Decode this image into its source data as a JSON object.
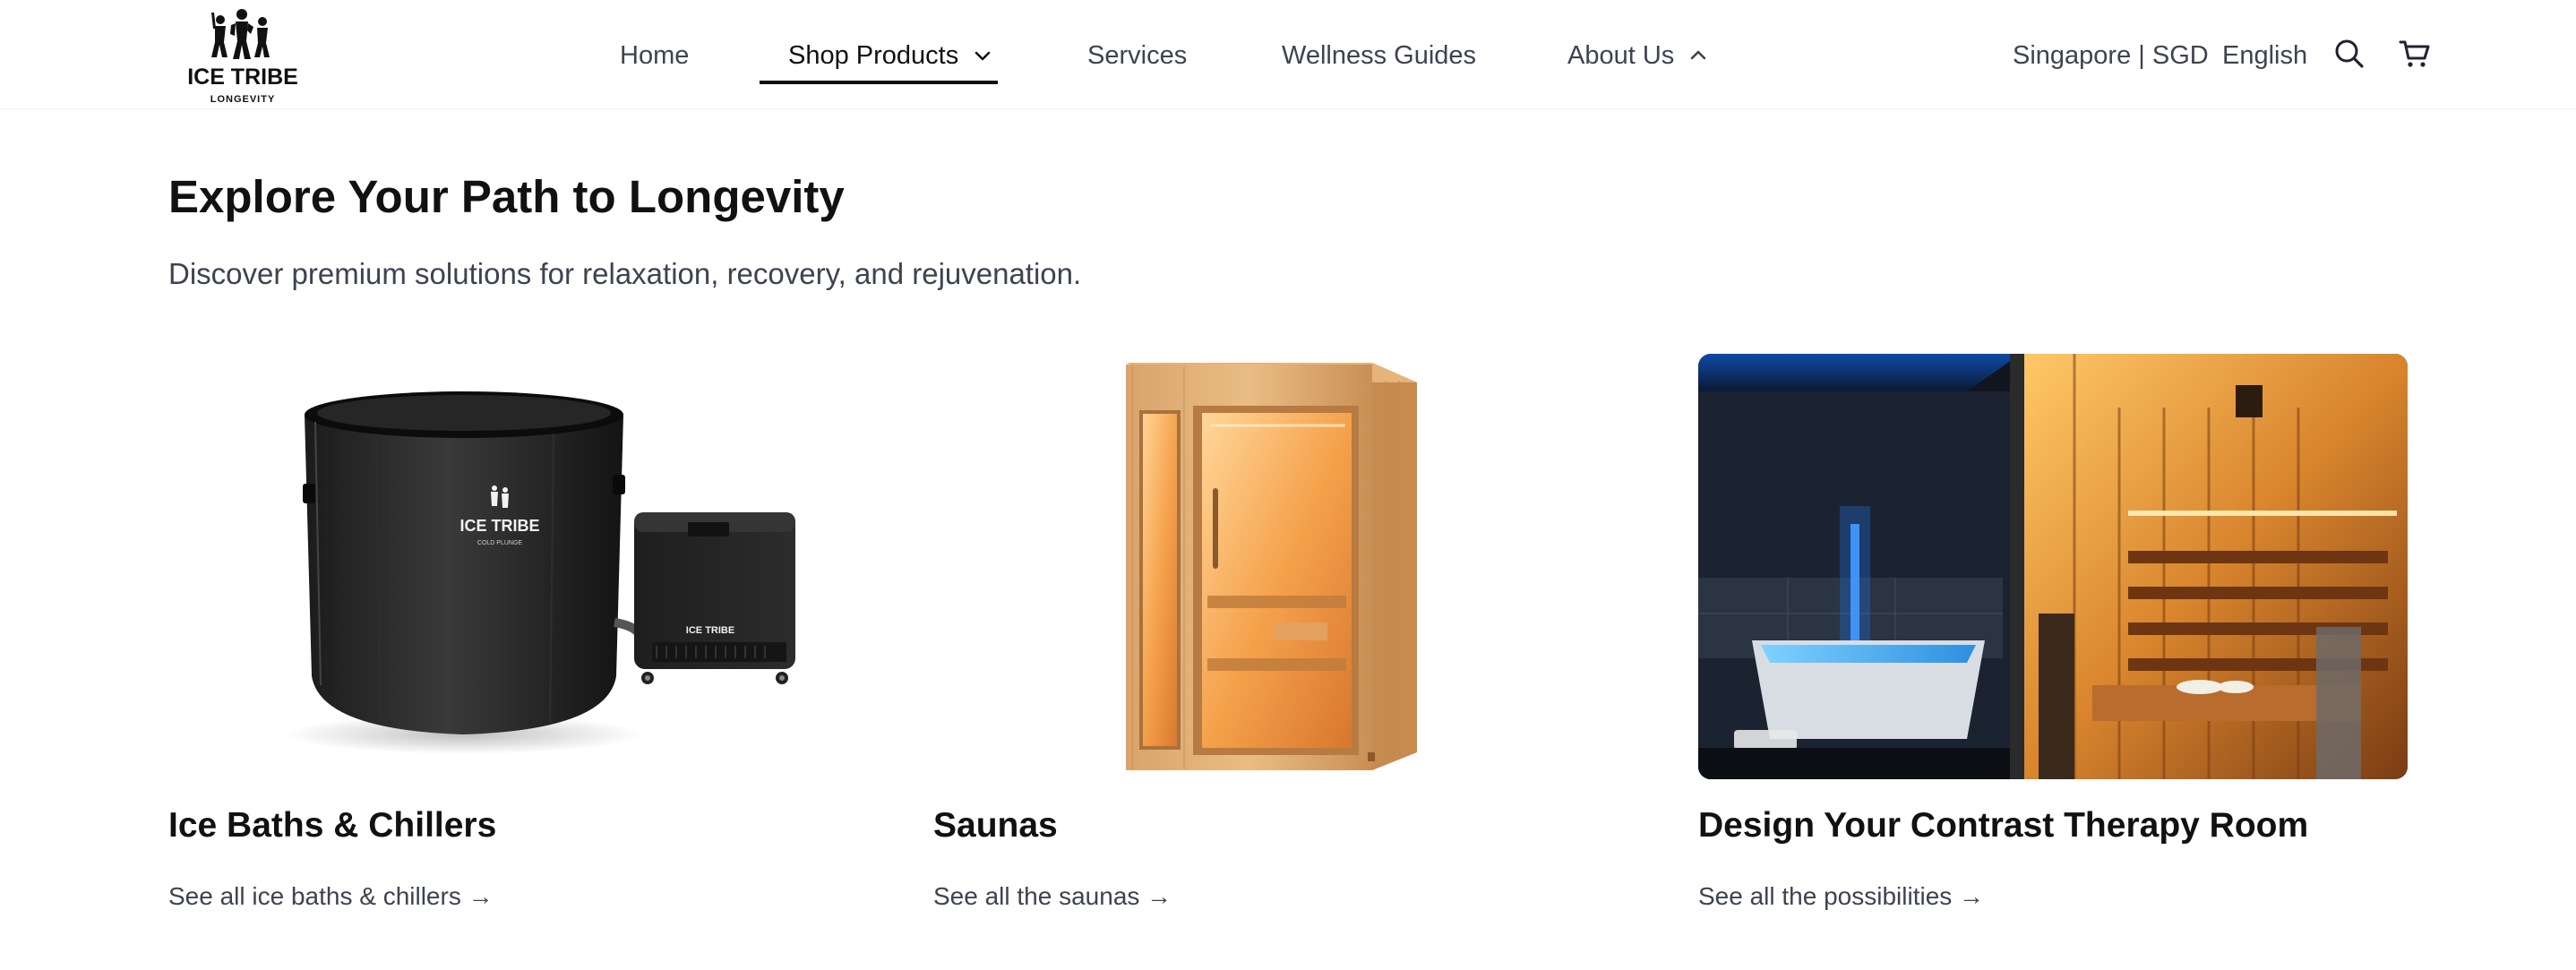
{
  "header": {
    "logo": {
      "text_top": "ICE TRIBE",
      "text_bottom": "LONGEVITY"
    },
    "nav": [
      {
        "label": "Home"
      },
      {
        "label": "Shop Products"
      },
      {
        "label": "Services"
      },
      {
        "label": "Wellness Guides"
      },
      {
        "label": "About Us"
      }
    ],
    "region": "Singapore | SGD",
    "language": "English",
    "icons": {
      "search": "search-icon",
      "cart": "cart-icon"
    }
  },
  "main": {
    "title": "Explore Your Path to Longevity",
    "subtitle": "Discover premium solutions for relaxation, recovery, and rejuvenation.",
    "cards": [
      {
        "title": "Ice Baths & Chillers",
        "link": "See all ice baths & chillers →",
        "image": "ice-bath-and-chiller",
        "product_brand": "ICE TRIBE",
        "product_subtitle": "COLD PLUNGE"
      },
      {
        "title": "Saunas",
        "link": "See all the saunas →",
        "image": "wooden-sauna-cabin"
      },
      {
        "title": "Design Your Contrast Therapy Room",
        "link": "See all the possibilities →",
        "image": "contrast-therapy-room"
      }
    ]
  },
  "colors": {
    "text": "#111111",
    "muted": "#3d4350",
    "accent_underline": "#111111"
  }
}
